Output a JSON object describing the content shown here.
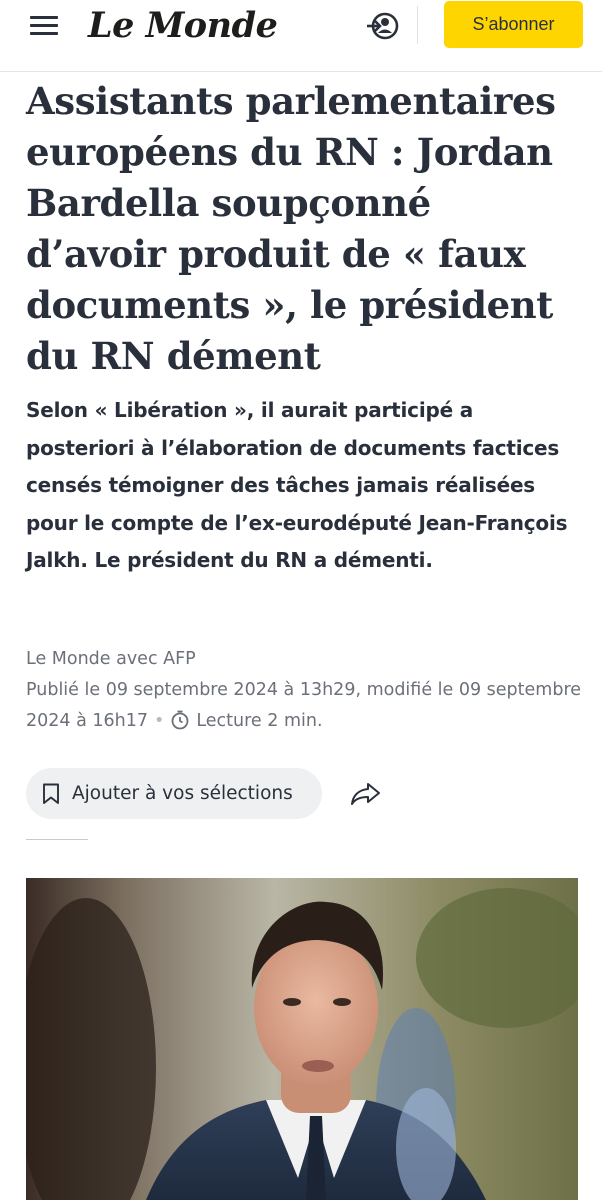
{
  "header": {
    "logo_text": "Le Monde",
    "subscribe_label": "S’abonner",
    "menu_icon": "hamburger-menu-icon",
    "account_icon": "account-login-icon"
  },
  "article": {
    "title": "Assistants parlementaires européens du RN : Jordan Bardella soupçonné d’avoir produit de « faux documents », le président du RN dément",
    "standfirst": "Selon « Libération », il aurait participé a posteriori à l’élaboration de documents factices censés témoigner des tâches jamais réalisées pour le compte de l’ex-eurodéputé Jean-François Jalkh. Le président du RN a démenti.",
    "byline": "Le Monde avec AFP",
    "published": "Publié le 09 septembre 2024 à 13h29, modifié le 09 septembre 2024 à 16h17",
    "separator": "•",
    "reading_time": "Lecture 2 min."
  },
  "actions": {
    "save_label": "Ajouter à vos sélections",
    "save_icon": "bookmark-icon",
    "share_icon": "share-arrow-icon"
  },
  "colors": {
    "accent": "#ffd500",
    "text": "#2a303b",
    "meta": "#6b7079",
    "pill_bg": "#eff0f1"
  }
}
